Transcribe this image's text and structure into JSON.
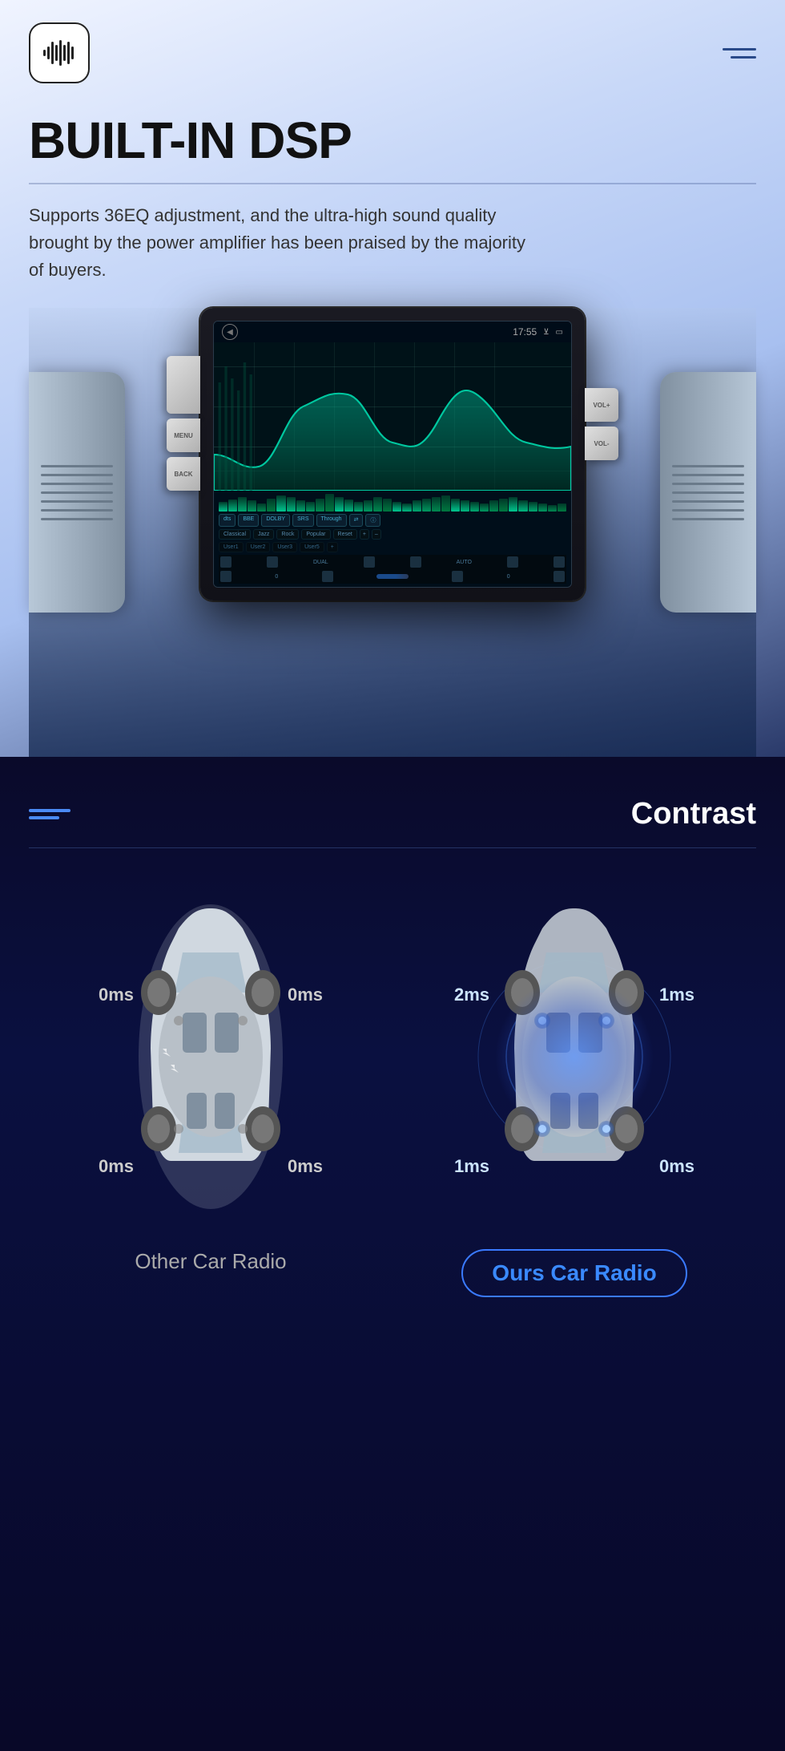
{
  "header": {
    "logo_alt": "audio logo",
    "menu_aria": "open menu"
  },
  "hero": {
    "title": "BUILT-IN DSP",
    "divider": true,
    "subtitle": "Supports 36EQ adjustment, and the ultra-high sound quality brought by the power amplifier has been praised by the majority of buyers."
  },
  "device": {
    "status_time": "17:55",
    "buttons": {
      "menu": "MENU",
      "back": "BACK",
      "vol_plus": "VOL+",
      "vol_minus": "VOL-"
    },
    "fx_labels": [
      "dts",
      "BBE",
      "DOLBY",
      "SRS",
      "Through",
      "",
      ""
    ],
    "presets": [
      "Classical",
      "Jazz",
      "Rock",
      "Popular",
      "Reset",
      ""
    ],
    "users": [
      "User1",
      "User2",
      "User3",
      "User5",
      "+"
    ]
  },
  "contrast_section": {
    "title": "Contrast",
    "other_car": {
      "label": "Other Car Radio",
      "timing": {
        "top_left": "0ms",
        "top_right": "0ms",
        "bottom_left": "0ms",
        "bottom_right": "0ms"
      }
    },
    "our_car": {
      "label": "Ours Car Radio",
      "timing": {
        "top_left": "2ms",
        "top_right": "1ms",
        "bottom_left": "1ms",
        "bottom_right": "0ms"
      }
    }
  }
}
